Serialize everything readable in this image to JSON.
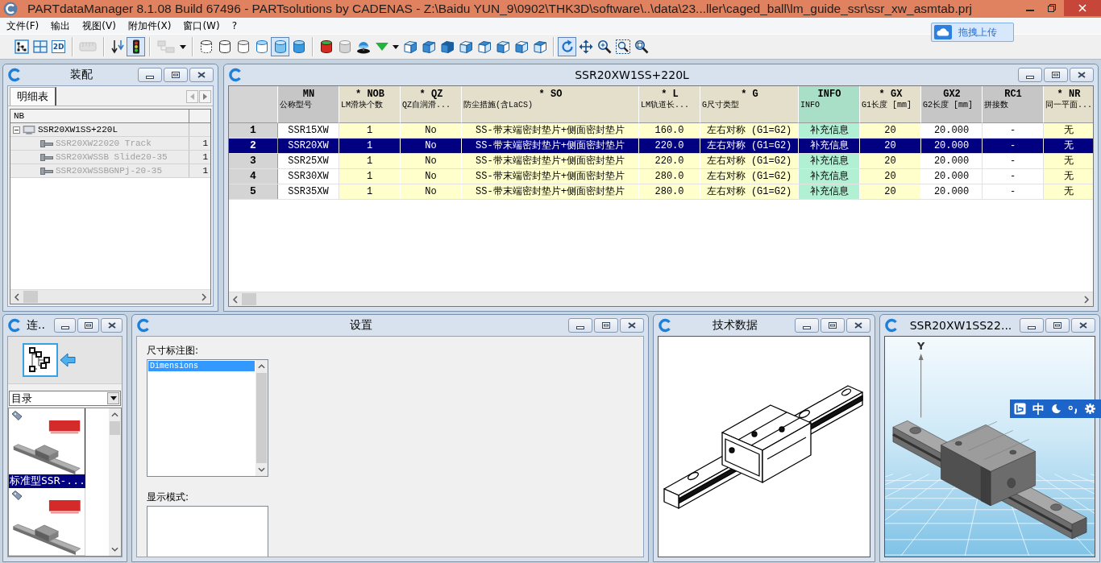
{
  "window": {
    "title": "PARTdataManager 8.1.08 Build 67496 - PARTsolutions by CADENAS - Z:\\Baidu YUN_9\\0902\\THK3D\\software\\..\\data\\23...ller\\caged_ball\\lm_guide_ssr\\ssr_xw_asmtab.prj"
  },
  "menu": [
    "文件(F)",
    "输出",
    "视图(V)",
    "附加件(X)",
    "窗口(W)",
    "?"
  ],
  "upload_button": {
    "label": "拖拽上传"
  },
  "toolbar": [
    [
      {
        "kind": "tree",
        "on": false,
        "disabled": false
      },
      {
        "kind": "grid",
        "on": false,
        "disabled": false
      },
      {
        "kind": "text",
        "label": "2D",
        "on": false,
        "disabled": false
      }
    ],
    [
      {
        "kind": "ruler",
        "on": false,
        "disabled": true
      }
    ],
    [
      {
        "kind": "arrows",
        "on": false,
        "disabled": false
      },
      {
        "kind": "traffic",
        "on": true,
        "disabled": false
      }
    ],
    [
      {
        "kind": "plugin",
        "on": false,
        "disabled": true
      },
      {
        "kind": "caret",
        "on": false,
        "disabled": false
      }
    ],
    [
      {
        "kind": "cyl-wire",
        "on": false,
        "disabled": false
      },
      {
        "kind": "cyl-hidden",
        "on": false,
        "disabled": false
      },
      {
        "kind": "cyl-outline",
        "on": false,
        "disabled": false
      },
      {
        "kind": "cyl-edge",
        "on": false,
        "disabled": false
      },
      {
        "kind": "cyl-shade",
        "on": true,
        "disabled": false
      },
      {
        "kind": "cyl-blue",
        "on": false,
        "disabled": false
      }
    ],
    [
      {
        "kind": "cyl-color",
        "on": false,
        "disabled": false
      },
      {
        "kind": "cyl-glass",
        "on": false,
        "disabled": false
      },
      {
        "kind": "probe",
        "on": false,
        "disabled": false
      },
      {
        "kind": "triangle",
        "on": false,
        "disabled": false
      },
      {
        "kind": "caret",
        "on": false,
        "disabled": false
      },
      {
        "kind": "cube",
        "on": false,
        "disabled": false
      },
      {
        "kind": "cube",
        "on": false,
        "disabled": false
      },
      {
        "kind": "cube",
        "on": false,
        "disabled": false
      },
      {
        "kind": "cube",
        "on": false,
        "disabled": false
      },
      {
        "kind": "cube",
        "on": false,
        "disabled": false
      },
      {
        "kind": "cube",
        "on": false,
        "disabled": false
      },
      {
        "kind": "cube",
        "on": false,
        "disabled": false
      },
      {
        "kind": "cube",
        "on": false,
        "disabled": false
      }
    ],
    [
      {
        "kind": "rotate",
        "on": true,
        "disabled": false
      },
      {
        "kind": "pan",
        "on": false,
        "disabled": false
      },
      {
        "kind": "zoom",
        "on": false,
        "disabled": false
      },
      {
        "kind": "zoom-box",
        "on": false,
        "disabled": false
      },
      {
        "kind": "zoom-fit",
        "on": false,
        "disabled": false
      }
    ]
  ],
  "assembly_panel": {
    "title": "装配",
    "tabs": [
      {
        "label": "明细表",
        "selected": true
      }
    ],
    "columns": [
      "NB"
    ],
    "tree": [
      {
        "label": "SSR20XW1SS+220L",
        "expanded": true,
        "disabled": false,
        "children": [
          {
            "label": "SSR20XW22020 Track",
            "quantity": "1",
            "disabled": true
          },
          {
            "label": "SSR20XWSSB Slide20-35",
            "quantity": "1",
            "disabled": true
          },
          {
            "label": "SSR20XWSSBGNPj-20-35",
            "quantity": "1",
            "disabled": true
          }
        ]
      }
    ]
  },
  "table_panel": {
    "title": "SSR20XW1SS+220L",
    "columns": [
      {
        "code": "MN",
        "label": "公称型号",
        "kind": "fixed"
      },
      {
        "code": "* NOB",
        "label": "LM滑块个数",
        "kind": "param"
      },
      {
        "code": "* QZ",
        "label": "QZ自润滑...",
        "kind": "param"
      },
      {
        "code": "* SO",
        "label": "防尘措施(含LaCS)",
        "kind": "param"
      },
      {
        "code": "* L",
        "label": "LM轨道长...",
        "kind": "param"
      },
      {
        "code": "* G",
        "label": "G尺寸类型",
        "kind": "param"
      },
      {
        "code": "INFO",
        "label": "INFO",
        "kind": "info"
      },
      {
        "code": "* GX",
        "label": "G1长度 [mm]",
        "kind": "param"
      },
      {
        "code": "GX2",
        "label": "G2长度 [mm]",
        "kind": "fixed"
      },
      {
        "code": "RC1",
        "label": "拼接数",
        "kind": "fixed"
      },
      {
        "code": "* NR",
        "label": "同一平面...",
        "kind": "param"
      }
    ],
    "rows": [
      {
        "number": "1",
        "selected": false,
        "cells": [
          "SSR15XW",
          "1",
          "No",
          "SS-带末端密封垫片+侧面密封垫片",
          "160.0",
          "左右对称 (G1=G2)",
          "补充信息",
          "20",
          "20.000",
          "-",
          "无"
        ]
      },
      {
        "number": "2",
        "selected": true,
        "cells": [
          "SSR20XW",
          "1",
          "No",
          "SS-带末端密封垫片+侧面密封垫片",
          "220.0",
          "左右对称 (G1=G2)",
          "补充信息",
          "20",
          "20.000",
          "-",
          "无"
        ]
      },
      {
        "number": "3",
        "selected": false,
        "cells": [
          "SSR25XW",
          "1",
          "No",
          "SS-带末端密封垫片+侧面密封垫片",
          "220.0",
          "左右对称 (G1=G2)",
          "补充信息",
          "20",
          "20.000",
          "-",
          "无"
        ]
      },
      {
        "number": "4",
        "selected": false,
        "cells": [
          "SSR30XW",
          "1",
          "No",
          "SS-带末端密封垫片+侧面密封垫片",
          "280.0",
          "左右对称 (G1=G2)",
          "补充信息",
          "20",
          "20.000",
          "-",
          "无"
        ]
      },
      {
        "number": "5",
        "selected": false,
        "cells": [
          "SSR35XW",
          "1",
          "No",
          "SS-带末端密封垫片+侧面密封垫片",
          "280.0",
          "左右对称 (G1=G2)",
          "补充信息",
          "20",
          "20.000",
          "-",
          "无"
        ]
      }
    ]
  },
  "link_panel": {
    "title": "连..",
    "dropdown": {
      "value": "目录"
    },
    "items": [
      {
        "label": "标准型SSR-...",
        "selected": true
      },
      {
        "selected": false
      }
    ]
  },
  "settings_panel": {
    "title": "设置",
    "fields": [
      {
        "label": "尺寸标注图:",
        "items": [
          {
            "label": "Dimensions",
            "selected": true
          }
        ]
      },
      {
        "label": "显示模式:"
      }
    ]
  },
  "drawing_panel": {
    "title": "技术数据"
  },
  "view_panel": {
    "title": "SSR20XW1SS22...",
    "axis_label": "Y"
  },
  "ime_bar": {
    "mode": "中"
  }
}
